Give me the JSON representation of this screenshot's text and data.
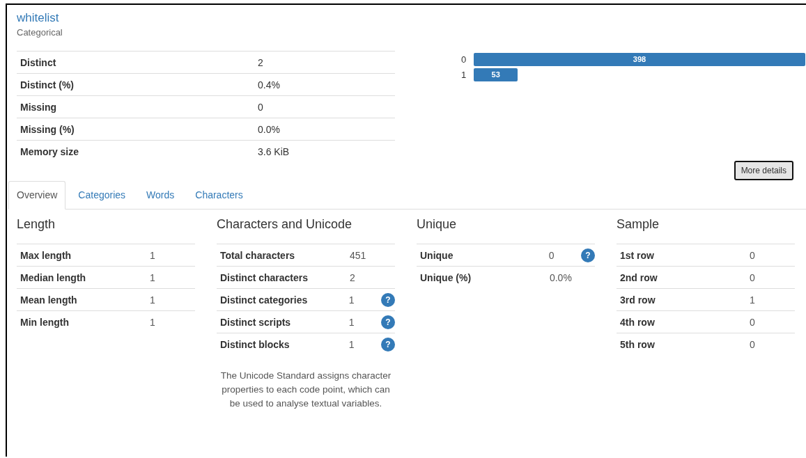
{
  "variable": {
    "name": "whitelist",
    "type": "Categorical"
  },
  "stats": [
    {
      "label": "Distinct",
      "value": "2"
    },
    {
      "label": "Distinct (%)",
      "value": "0.4%"
    },
    {
      "label": "Missing",
      "value": "0"
    },
    {
      "label": "Missing (%)",
      "value": "0.0%"
    },
    {
      "label": "Memory size",
      "value": "3.6 KiB"
    }
  ],
  "chart_data": {
    "type": "bar",
    "orientation": "horizontal",
    "categories": [
      "0",
      "1"
    ],
    "values": [
      398,
      53
    ],
    "data_labels": true
  },
  "more_button": "More details",
  "tabs": [
    {
      "label": "Overview",
      "selected": true
    },
    {
      "label": "Categories",
      "selected": false
    },
    {
      "label": "Words",
      "selected": false
    },
    {
      "label": "Characters",
      "selected": false
    }
  ],
  "sections": [
    {
      "title": "Length",
      "rows": [
        {
          "label": "Max length",
          "value": "1"
        },
        {
          "label": "Median length",
          "value": "1"
        },
        {
          "label": "Mean length",
          "value": "1"
        },
        {
          "label": "Min length",
          "value": "1"
        }
      ]
    },
    {
      "title": "Characters and Unicode",
      "rows": [
        {
          "label": "Total characters",
          "value": "451"
        },
        {
          "label": "Distinct characters",
          "value": "2"
        },
        {
          "label": "Distinct categories",
          "value": "1",
          "help": "?"
        },
        {
          "label": "Distinct scripts",
          "value": "1",
          "help": "?"
        },
        {
          "label": "Distinct blocks",
          "value": "1",
          "help": "?"
        }
      ],
      "note": "The Unicode Standard assigns character properties to each code point, which can be used to analyse textual variables."
    },
    {
      "title": "Unique",
      "rows": [
        {
          "label": "Unique",
          "value": "0",
          "help": "?"
        },
        {
          "label": "Unique (%)",
          "value": "0.0%"
        }
      ]
    },
    {
      "title": "Sample",
      "rows": [
        {
          "label": "1st row",
          "value": "0"
        },
        {
          "label": "2nd row",
          "value": "0"
        },
        {
          "label": "3rd row",
          "value": "1"
        },
        {
          "label": "4th row",
          "value": "0"
        },
        {
          "label": "5th row",
          "value": "0"
        }
      ]
    }
  ]
}
